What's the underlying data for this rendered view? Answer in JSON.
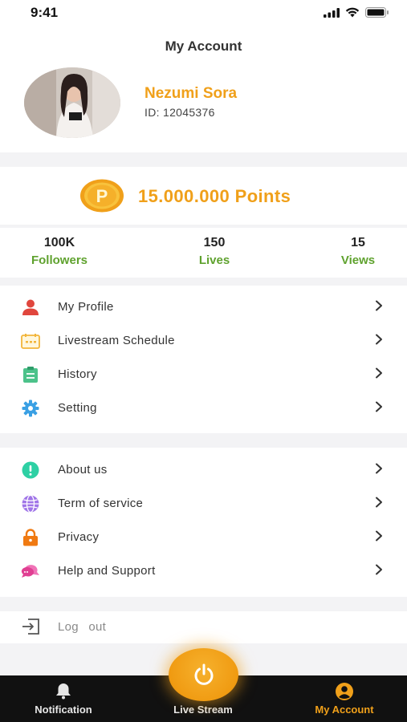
{
  "status_bar": {
    "time": "9:41"
  },
  "header": {
    "title": "My Account",
    "user_name": "Nezumi Sora",
    "user_id": "ID: 12045376"
  },
  "points": {
    "text": "15.000.000 Points",
    "coin_letter": "P"
  },
  "stats": [
    {
      "value": "100K",
      "label": "Followers"
    },
    {
      "value": "150",
      "label": "Lives"
    },
    {
      "value": "15",
      "label": "Views"
    }
  ],
  "menu_primary": [
    {
      "label": "My Profile",
      "icon": "user-icon"
    },
    {
      "label": "Livestream Schedule",
      "icon": "calendar-icon"
    },
    {
      "label": "History",
      "icon": "clipboard-icon"
    },
    {
      "label": "Setting",
      "icon": "gear-icon"
    }
  ],
  "menu_secondary": [
    {
      "label": "About us",
      "icon": "info-icon"
    },
    {
      "label": "Term of service",
      "icon": "globe-icon"
    },
    {
      "label": "Privacy",
      "icon": "lock-icon"
    },
    {
      "label": "Help and Support",
      "icon": "chat-icon"
    }
  ],
  "logout": {
    "label": "Log out",
    "icon": "logout-icon"
  },
  "bottom_nav": {
    "items": [
      {
        "label": "Notification",
        "icon": "bell-icon"
      },
      {
        "label": "Live Stream",
        "icon": "power-icon"
      },
      {
        "label": "My Account",
        "icon": "account-icon"
      }
    ],
    "active_index": 2
  },
  "colors": {
    "accent": "#f0a01a",
    "stat_label": "#5fa22e",
    "nav_background": "#111111"
  }
}
